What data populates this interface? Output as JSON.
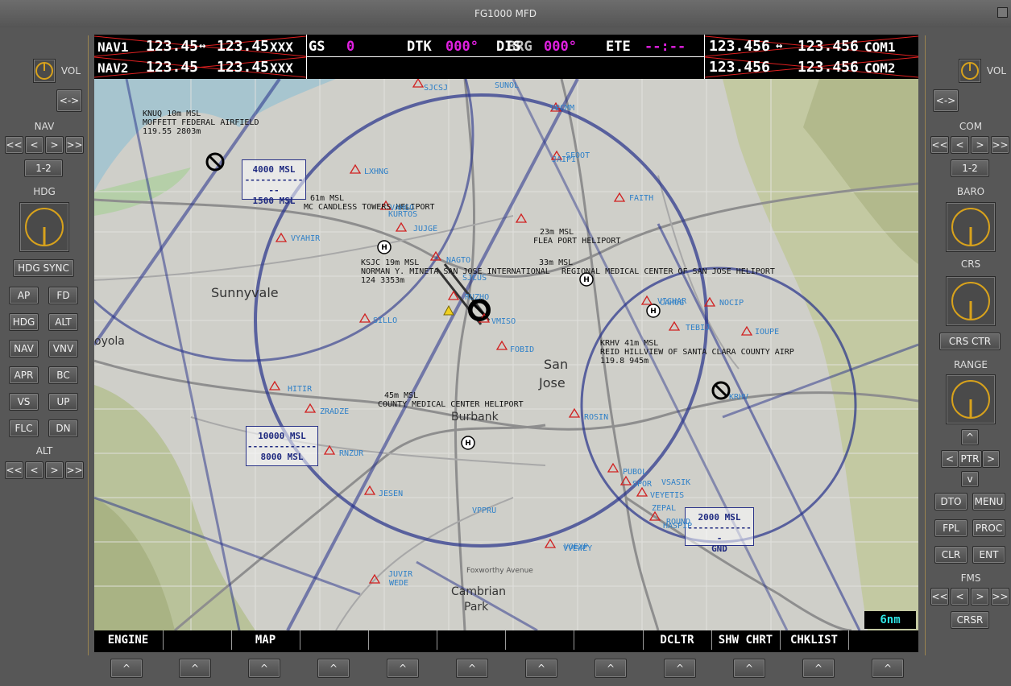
{
  "window": {
    "title": "FG1000 MFD"
  },
  "left_panel": {
    "vol_label": "VOL",
    "swap_label": "<->",
    "nav_label": "NAV",
    "freq_buttons": [
      "<<",
      "<",
      ">",
      ">>"
    ],
    "one_two_label": "1-2",
    "hdg_label": "HDG",
    "hdg_sync_label": "HDG SYNC",
    "ap_buttons": [
      [
        "AP",
        "FD"
      ],
      [
        "HDG",
        "ALT"
      ],
      [
        "NAV",
        "VNV"
      ],
      [
        "APR",
        "BC"
      ],
      [
        "VS",
        "UP"
      ],
      [
        "FLC",
        "DN"
      ]
    ],
    "alt_label": "ALT",
    "alt_buttons": [
      "<<",
      "<",
      ">",
      ">>"
    ]
  },
  "right_panel": {
    "vol_label": "VOL",
    "swap_label": "<->",
    "com_label": "COM",
    "freq_buttons": [
      "<<",
      "<",
      ">",
      ">>"
    ],
    "one_two_label": "1-2",
    "baro_label": "BARO",
    "crs_label": "CRS",
    "crs_ctr_label": "CRS CTR",
    "range_label": "RANGE",
    "joystick": {
      "up": "^",
      "left": "<",
      "center": "PTR",
      "right": ">",
      "down": "v"
    },
    "fms_buttons": [
      [
        "DTO",
        "MENU"
      ],
      [
        "FPL",
        "PROC"
      ],
      [
        "CLR",
        "ENT"
      ]
    ],
    "fms_label": "FMS",
    "fms_freq_buttons": [
      "<<",
      "<",
      ">",
      ">>"
    ],
    "crsr_label": "CRSR"
  },
  "header": {
    "nav1": {
      "label": "NAV1",
      "active": "123.45",
      "arrow": "↔",
      "standby": "123.45",
      "id": "XXX"
    },
    "nav2": {
      "label": "NAV2",
      "active": "123.45",
      "standby": "123.45",
      "id": "XXX"
    },
    "gs_label": "GS",
    "gs_value": "0",
    "dtk_label": "DTK",
    "dtk_value": "000°",
    "dis_label": "DIS",
    "brg_label": "BRG",
    "brg_value": "000°",
    "ete_label": "ETE",
    "ete_value": "--:--",
    "com1": {
      "active": "123.456",
      "arrow": "↔",
      "standby": "123.456",
      "label": "COM1"
    },
    "com2": {
      "active": "123.456",
      "standby": "123.456",
      "label": "COM2"
    }
  },
  "map": {
    "range": "6nm",
    "airports": [
      {
        "lines": [
          "KNUQ 10m MSL",
          "MOFFETT FEDERAL AIRFIELD",
          "119.55 2803m"
        ]
      },
      {
        "lines": [
          "61m MSL",
          "MC CANDLESS TOWERS HELIPORT"
        ]
      },
      {
        "lines": [
          "23m MSL",
          "FLEA PORT HELIPORT"
        ]
      },
      {
        "lines": [
          "KSJC 19m MSL",
          "NORMAN Y. MINETA SAN JOSE INTERNATIONAL",
          "124 3353m"
        ]
      },
      {
        "lines": [
          "33m MSL",
          "REGIONAL MEDICAL CENTER OF SAN JOSE HELIPORT"
        ]
      },
      {
        "lines": [
          "KRHV 41m MSL",
          "REID HILLVIEW OF SANTA CLARA COUNTY AIRP",
          "119.8 945m"
        ]
      },
      {
        "lines": [
          "45m MSL",
          "COUNTY MEDICAL CENTER HELIPORT"
        ]
      }
    ],
    "towns": [
      "Sunnyvale",
      "San",
      "Jose",
      "Burbank",
      "Cambrian",
      "Park",
      "oyola"
    ],
    "street": "Foxworthy Avenue",
    "airspace_labels": [
      {
        "top": "4000 MSL",
        "bottom": "1500 MSL"
      },
      {
        "top": "10000 MSL",
        "bottom": "8000 MSL"
      },
      {
        "top": "2000 MSL",
        "bottom": "GND"
      }
    ],
    "fixes": [
      "SUNOL",
      "SJCSJ",
      "VPCMM",
      "JAIPI",
      "SFOOT",
      "FAITH",
      "LXHNG",
      "VYAHIR",
      "JUJGE",
      "VAHGO",
      "KURTOS",
      "NAGTO",
      "SJCUS",
      "RUZHO",
      "SILLO",
      "VMISO",
      "FOBID",
      "HITIR",
      "ZRADZE",
      "RNZUR",
      "JESEN",
      "VPPRU",
      "ROSIN",
      "VOEXP",
      "JUVIR",
      "WEDE",
      "VICHAR",
      "NOCIP",
      "TEBIJ",
      "IOUPE",
      "CAHOG",
      "KRHV",
      "PUBOL",
      "VSASIK",
      "VEYETIS",
      "SPOR",
      "ZEPAL",
      "HASPIP",
      "VVEWEY",
      "ROUND"
    ]
  },
  "softkeys": [
    "ENGINE",
    "",
    "MAP",
    "",
    "",
    "",
    "",
    "",
    "DCLTR",
    "SHW CHRT",
    "CHKLIST",
    ""
  ],
  "softkey_button_label": "^"
}
